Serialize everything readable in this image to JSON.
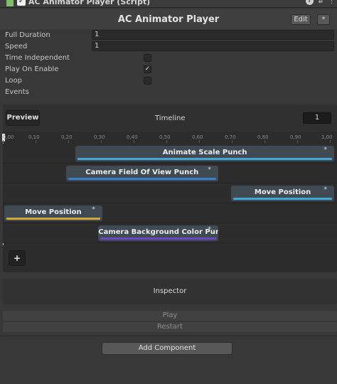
{
  "component": {
    "title": "AC Animator Player (Script)",
    "enabled": "✓",
    "icons": [
      "script-icon",
      "help-icon",
      "settings-icon",
      "menu-icon"
    ]
  },
  "header": {
    "title": "AC Animator Player",
    "edit_label": "Edit",
    "star_label": "*"
  },
  "properties": {
    "full_duration": {
      "label": "Full Duration",
      "value": "1"
    },
    "speed": {
      "label": "Speed",
      "value": "1"
    },
    "time_independent": {
      "label": "Time Independent",
      "checked": false
    },
    "play_on_enable": {
      "label": "Play On Enable",
      "checked": true,
      "mark": "✓"
    },
    "loop": {
      "label": "Loop",
      "checked": false
    },
    "events": {
      "label": "Events"
    }
  },
  "timeline": {
    "preview_label": "Preview",
    "title": "Timeline",
    "frame": "1",
    "ticks": [
      "0,00",
      "0,10",
      "0,20",
      "0,30",
      "0,40",
      "0,50",
      "0,60",
      "0,70",
      "0,80",
      "0,90",
      "1,00"
    ],
    "clips": [
      {
        "label": "Animate Scale Punch",
        "star": "*",
        "start": 0.22,
        "end": 1.0,
        "color": "#3fa8d8"
      },
      {
        "label": "Camera Field Of View Punch",
        "star": "*",
        "start": 0.19,
        "end": 0.65,
        "color": "#3a7fcf"
      },
      {
        "label": "Move Position",
        "star": "*",
        "start": 0.7,
        "end": 1.0,
        "color": "#3fa8d8"
      },
      {
        "label": "Move Position",
        "star": "*",
        "start": 0.0,
        "end": 0.3,
        "color": "#d1a93a"
      },
      {
        "label": "Camera Background Color Pun",
        "star": "*",
        "start": 0.29,
        "end": 0.65,
        "color": "#6c48c8"
      }
    ],
    "add_label": "+"
  },
  "inspector": {
    "label": "Inspector"
  },
  "actions": {
    "play_label": "Play",
    "restart_label": "Restart",
    "add_component_label": "Add Component"
  }
}
